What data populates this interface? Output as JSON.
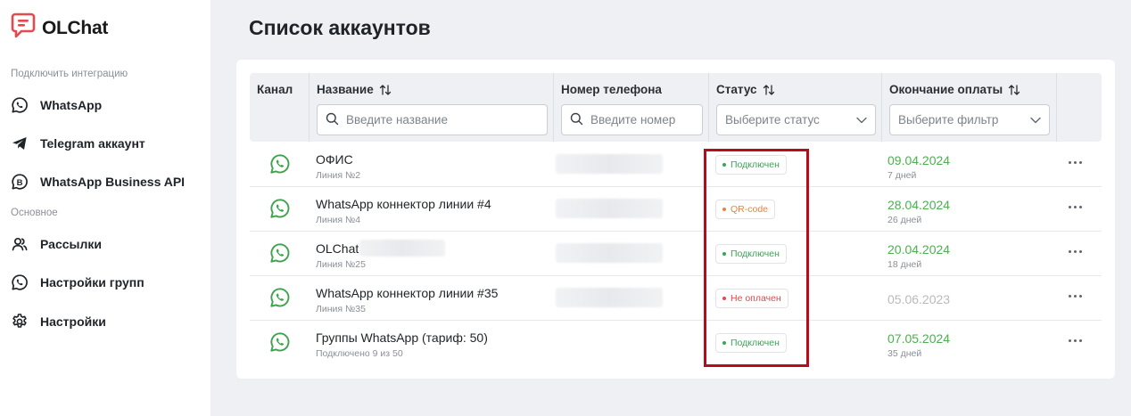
{
  "sidebar": {
    "brand": "OLChat",
    "section_integrations": "Подключить интеграцию",
    "integrations": [
      {
        "label": "WhatsApp",
        "icon": "whatsapp-icon"
      },
      {
        "label": "Telegram аккаунт",
        "icon": "telegram-icon"
      },
      {
        "label": "WhatsApp Business API",
        "icon": "business-b-icon"
      }
    ],
    "section_main": "Основное",
    "main_items": [
      {
        "label": "Рассылки",
        "icon": "users-icon"
      },
      {
        "label": "Настройки групп",
        "icon": "whatsapp-icon"
      },
      {
        "label": "Настройки",
        "icon": "gear-icon"
      }
    ]
  },
  "page": {
    "title": "Список аккаунтов"
  },
  "table": {
    "headers": {
      "channel": "Канал",
      "name": "Название",
      "phone": "Номер телефона",
      "status": "Статус",
      "payment_end": "Окончание оплаты"
    },
    "filters": {
      "name_placeholder": "Введите название",
      "phone_placeholder": "Введите номер",
      "status_placeholder": "Выберите статус",
      "payment_placeholder": "Выберите фильтр"
    },
    "rows": [
      {
        "name": "ОФИС",
        "sub": "Линия №2",
        "status": "Подключен",
        "status_kind": "connected",
        "date": "09.04.2024",
        "days": "7 дней",
        "date_kind": "active"
      },
      {
        "name": "WhatsApp коннектор линии #4",
        "sub": "Линия №4",
        "status": "QR-code",
        "status_kind": "qr",
        "date": "28.04.2024",
        "days": "26 дней",
        "date_kind": "active"
      },
      {
        "name": "OLChat",
        "sub": "Линия №25",
        "status": "Подключен",
        "status_kind": "connected",
        "date": "20.04.2024",
        "days": "18 дней",
        "date_kind": "active"
      },
      {
        "name": "WhatsApp коннектор линии #35",
        "sub": "Линия №35",
        "status": "Не оплачен",
        "status_kind": "unpaid",
        "date": "05.06.2023",
        "days": "",
        "date_kind": "expired"
      },
      {
        "name": "Группы WhatsApp (тариф: 50)",
        "sub": "Подключено 9 из 50",
        "status": "Подключен",
        "status_kind": "connected",
        "date": "07.05.2024",
        "days": "35 дней",
        "date_kind": "active"
      }
    ]
  },
  "colors": {
    "brand_red": "#e5484d",
    "whatsapp_green": "#3fa34d",
    "connected": "#36a852",
    "qr": "#e8833a",
    "unpaid": "#e5484d",
    "date_active": "#4caf50",
    "date_expired": "#b6bac0",
    "highlight": "#b80d18"
  }
}
